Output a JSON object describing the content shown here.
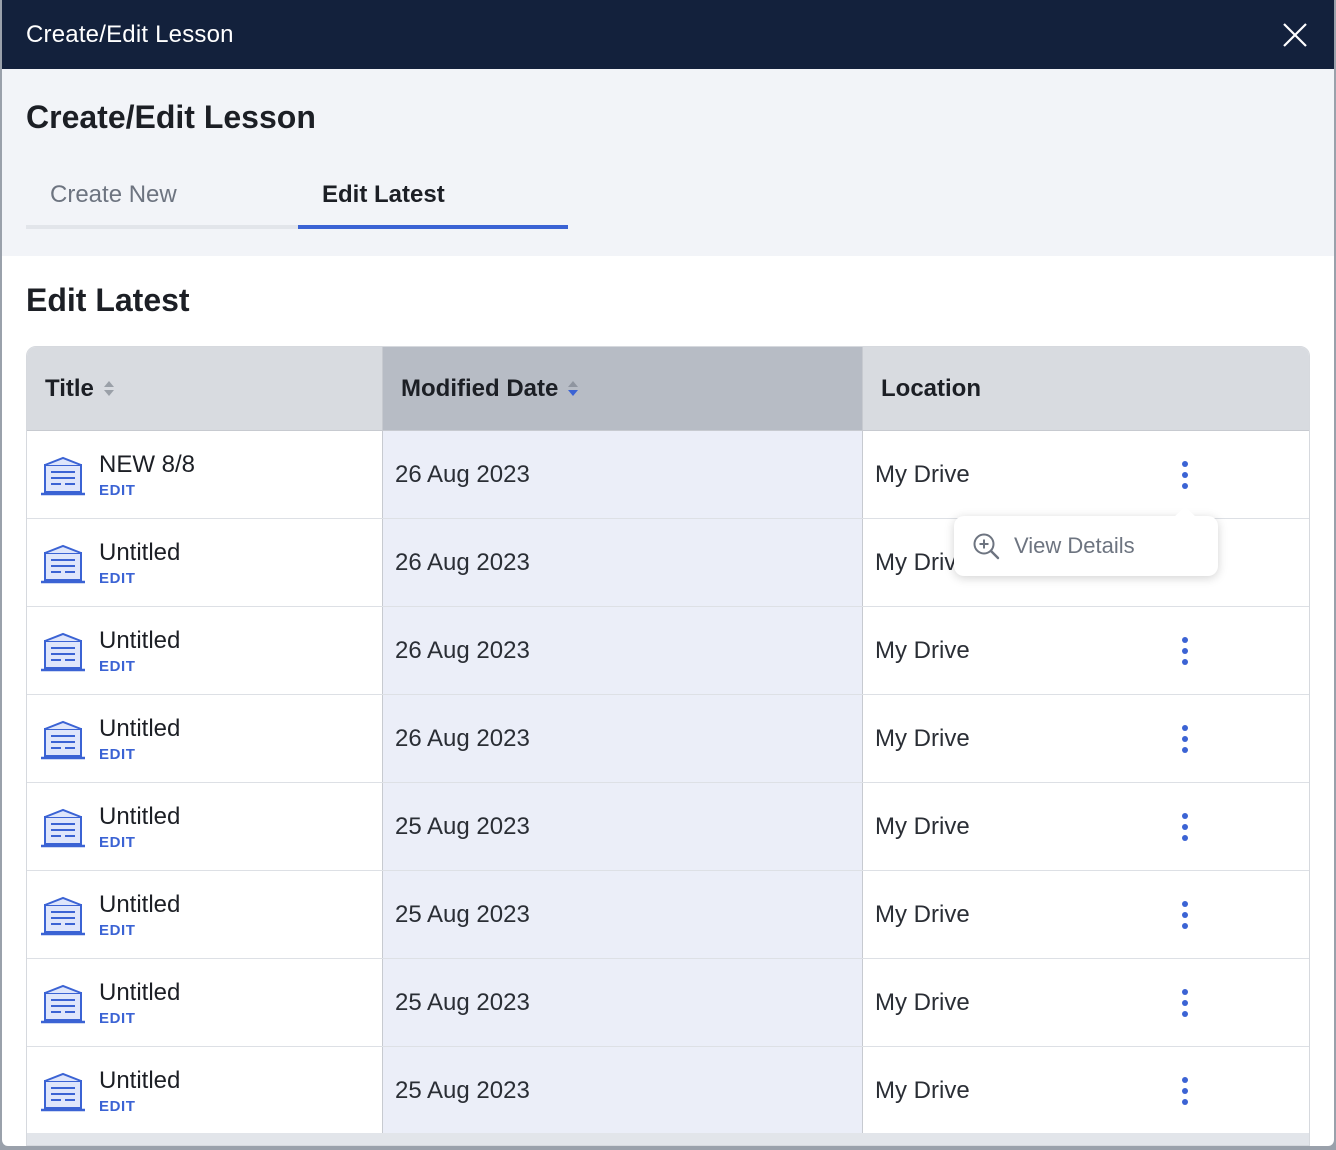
{
  "window": {
    "title": "Create/Edit Lesson"
  },
  "page": {
    "heading": "Create/Edit Lesson",
    "tabs": [
      {
        "label": "Create New",
        "active": false
      },
      {
        "label": "Edit Latest",
        "active": true
      }
    ],
    "section_title": "Edit Latest"
  },
  "table": {
    "columns": {
      "title": "Title",
      "modified_date": "Modified Date",
      "location": "Location"
    },
    "sort": {
      "column": "Modified Date",
      "direction": "descending"
    },
    "rows": [
      {
        "title": "NEW 8/8",
        "action": "EDIT",
        "modified": "26 Aug 2023",
        "location": "My Drive"
      },
      {
        "title": "Untitled",
        "action": "EDIT",
        "modified": "26 Aug 2023",
        "location": "My Drive"
      },
      {
        "title": "Untitled",
        "action": "EDIT",
        "modified": "26 Aug 2023",
        "location": "My Drive"
      },
      {
        "title": "Untitled",
        "action": "EDIT",
        "modified": "26 Aug 2023",
        "location": "My Drive"
      },
      {
        "title": "Untitled",
        "action": "EDIT",
        "modified": "25 Aug 2023",
        "location": "My Drive"
      },
      {
        "title": "Untitled",
        "action": "EDIT",
        "modified": "25 Aug 2023",
        "location": "My Drive"
      },
      {
        "title": "Untitled",
        "action": "EDIT",
        "modified": "25 Aug 2023",
        "location": "My Drive"
      },
      {
        "title": "Untitled",
        "action": "EDIT",
        "modified": "25 Aug 2023",
        "location": "My Drive"
      }
    ]
  },
  "row_menu": {
    "item_label": "View Details",
    "icon": "zoom-in-icon"
  },
  "colors": {
    "titlebar": "#13213c",
    "accent": "#3b63d4",
    "header_bg": "#f2f4f8",
    "sorted_column_bg": "#ebeef8"
  }
}
